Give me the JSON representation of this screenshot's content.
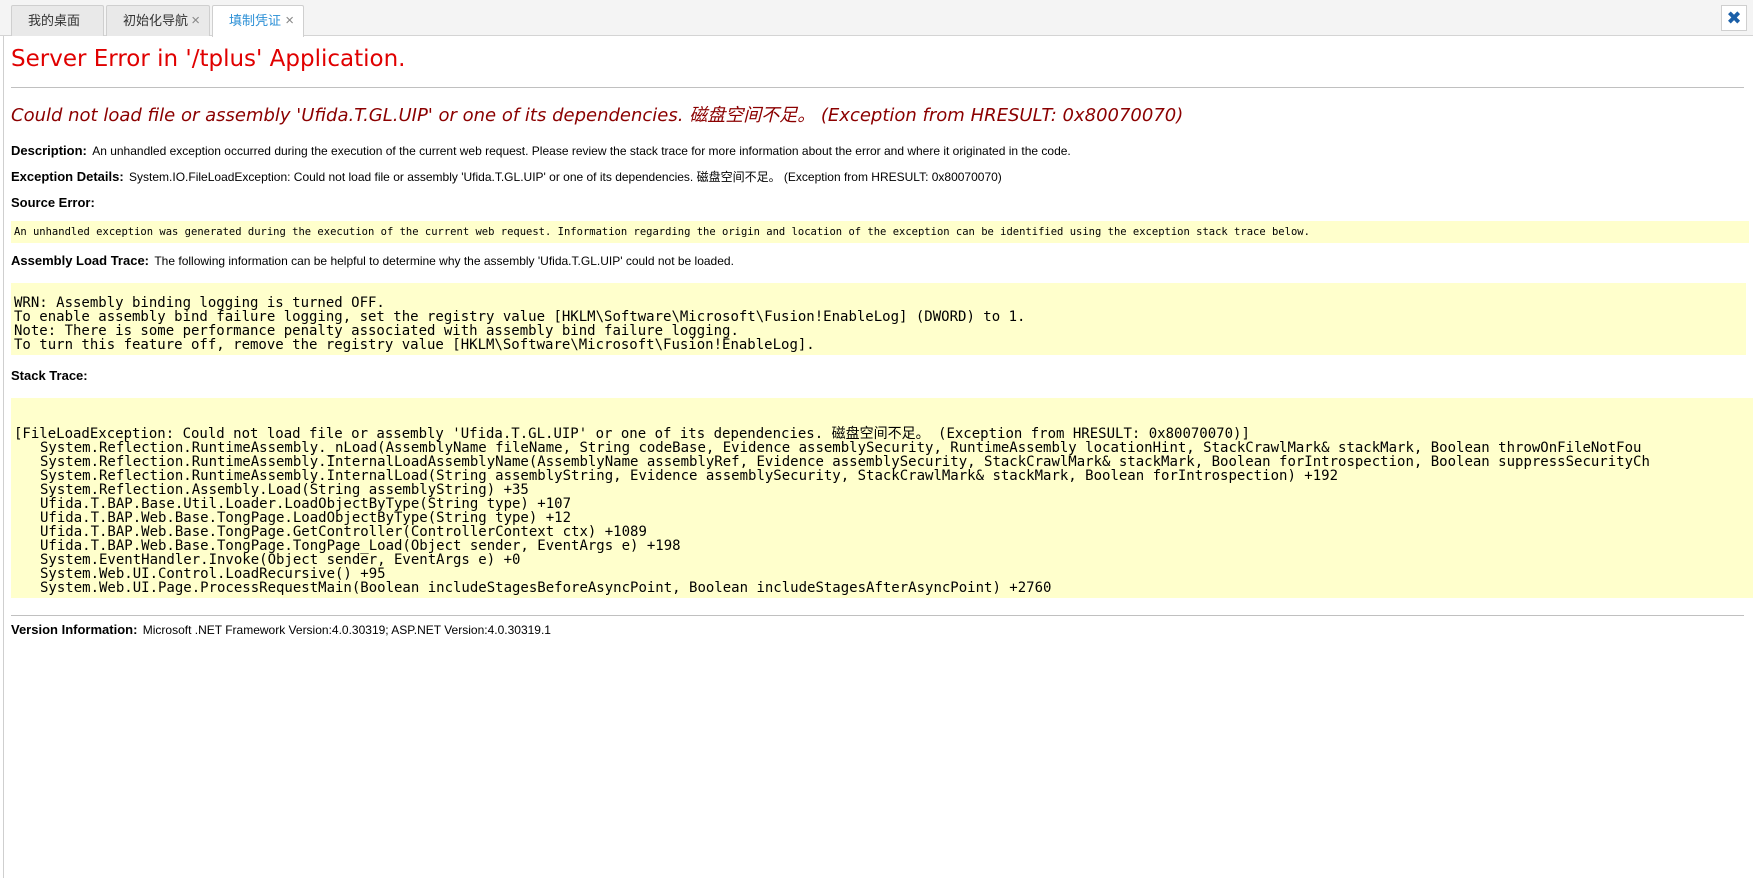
{
  "tabs": [
    {
      "label": "我的桌面",
      "closable": false,
      "active": false
    },
    {
      "label": "初始化导航",
      "closable": true,
      "active": false
    },
    {
      "label": "填制凭证",
      "closable": true,
      "active": true
    }
  ],
  "tab_close_glyph": "×",
  "close_all_glyph": "✖",
  "error_title": "Server Error in '/tplus' Application.",
  "error_message": "Could not load file or assembly 'Ufida.T.GL.UIP' or one of its dependencies. 磁盘空间不足。 (Exception from HRESULT: 0x80070070)",
  "description": {
    "label": "Description:",
    "text": "An unhandled exception occurred during the execution of the current web request. Please review the stack trace for more information about the error and where it originated in the code."
  },
  "exception_details": {
    "label": "Exception Details:",
    "text": "System.IO.FileLoadException: Could not load file or assembly 'Ufida.T.GL.UIP' or one of its dependencies. 磁盘空间不足。 (Exception from HRESULT: 0x80070070)"
  },
  "source_error": {
    "label": "Source Error:",
    "text": "An unhandled exception was generated during the execution of the current web request. Information regarding the origin and location of the exception can be identified using the exception stack trace below."
  },
  "assembly_load_trace": {
    "label": "Assembly Load Trace:",
    "text": "The following information can be helpful to determine why the assembly 'Ufida.T.GL.UIP' could not be loaded.",
    "lines": [
      "WRN: Assembly binding logging is turned OFF.",
      "To enable assembly bind failure logging, set the registry value [HKLM\\Software\\Microsoft\\Fusion!EnableLog] (DWORD) to 1.",
      "Note: There is some performance penalty associated with assembly bind failure logging.",
      "To turn this feature off, remove the registry value [HKLM\\Software\\Microsoft\\Fusion!EnableLog]."
    ]
  },
  "stack_trace": {
    "label": "Stack Trace:",
    "header": "[FileLoadException: Could not load file or assembly 'Ufida.T.GL.UIP' or one of its dependencies. 磁盘空间不足。 (Exception from HRESULT: 0x80070070)]",
    "frames": [
      "System.Reflection.RuntimeAssembly._nLoad(AssemblyName fileName, String codeBase, Evidence assemblySecurity, RuntimeAssembly locationHint, StackCrawlMark& stackMark, Boolean throwOnFileNotFou",
      "System.Reflection.RuntimeAssembly.InternalLoadAssemblyName(AssemblyName assemblyRef, Evidence assemblySecurity, StackCrawlMark& stackMark, Boolean forIntrospection, Boolean suppressSecurityCh",
      "System.Reflection.RuntimeAssembly.InternalLoad(String assemblyString, Evidence assemblySecurity, StackCrawlMark& stackMark, Boolean forIntrospection) +192",
      "System.Reflection.Assembly.Load(String assemblyString) +35",
      "Ufida.T.BAP.Base.Util.Loader.LoadObjectByType(String type) +107",
      "Ufida.T.BAP.Web.Base.TongPage.LoadObjectByType(String type) +12",
      "Ufida.T.BAP.Web.Base.TongPage.GetController(ControllerContext ctx) +1089",
      "Ufida.T.BAP.Web.Base.TongPage.TongPage_Load(Object sender, EventArgs e) +198",
      "System.EventHandler.Invoke(Object sender, EventArgs e) +0",
      "System.Web.UI.Control.LoadRecursive() +95",
      "System.Web.UI.Page.ProcessRequestMain(Boolean includeStagesBeforeAsyncPoint, Boolean includeStagesAfterAsyncPoint) +2760"
    ]
  },
  "version_information": {
    "label": "Version Information:",
    "text": "Microsoft .NET Framework Version:4.0.30319; ASP.NET Version:4.0.30319.1"
  },
  "colors": {
    "title_red": "#e00000",
    "message_darkred": "#8b0000",
    "code_bg": "#ffffcc",
    "active_tab_blue": "#2b8fd6"
  }
}
